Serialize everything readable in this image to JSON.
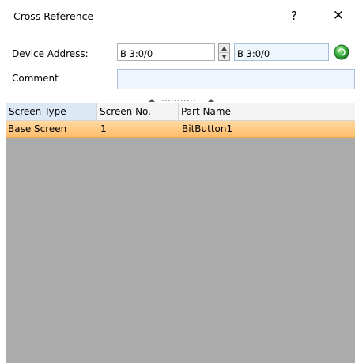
{
  "window": {
    "title": "Cross Reference",
    "help_label": "?",
    "close_label": "✕"
  },
  "form": {
    "device_address_label": "Device Address:",
    "address_from": "B 3:0/0",
    "address_to": "B 3:0/0",
    "comment_label": "Comment",
    "comment_value": ""
  },
  "table": {
    "columns": [
      "Screen Type",
      "Screen No.",
      "Part Name"
    ],
    "rows": [
      {
        "screen_type": "Base Screen",
        "screen_no": "1",
        "part_name": "BitButton1"
      }
    ]
  },
  "colors": {
    "selected_row": "#ffc47a",
    "grid_background": "#ababab",
    "go_button": "#3cb043"
  },
  "icons": {
    "spin": "spin-up-down-icon",
    "go": "go-green-icon",
    "splitter": "splitter-grip-icon"
  }
}
